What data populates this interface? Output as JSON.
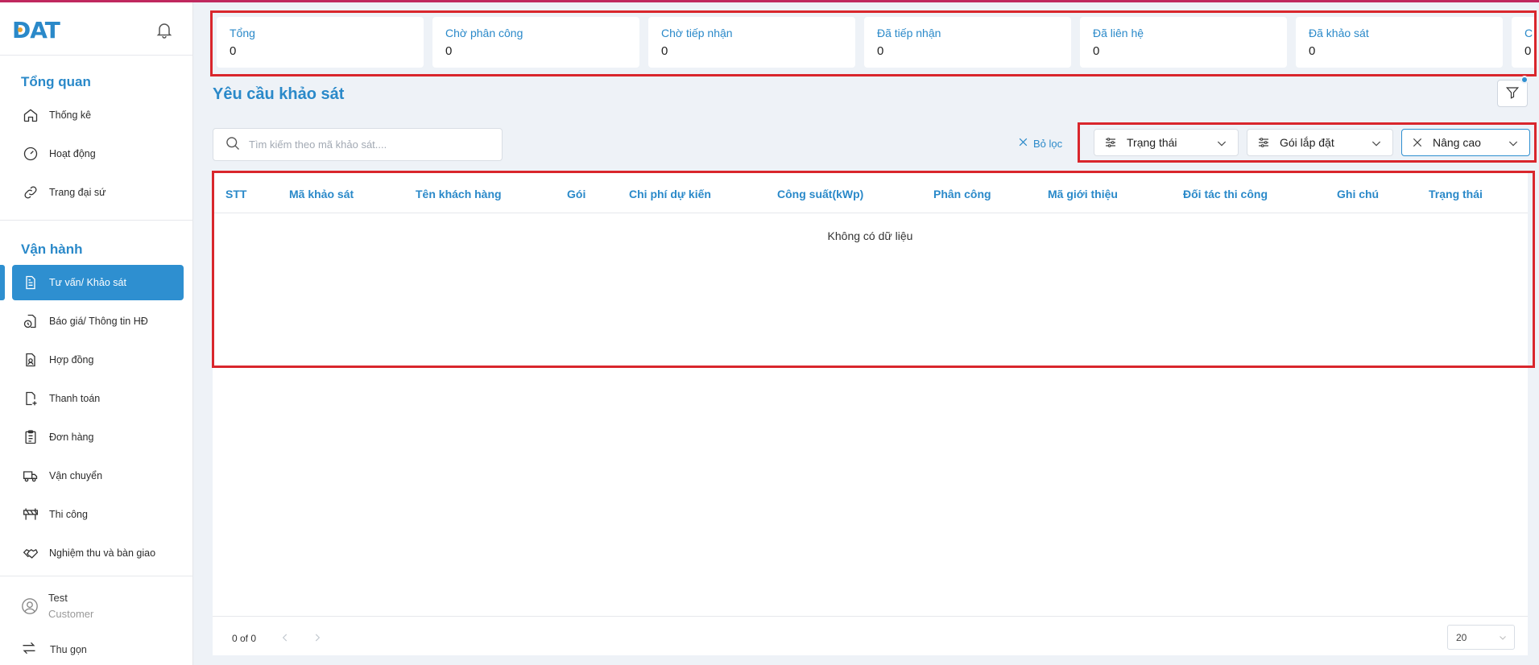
{
  "brand": {
    "logo_text": "DAT"
  },
  "sidebar": {
    "section_overview": "Tổng quan",
    "overview_items": [
      {
        "label": "Thống kê",
        "icon": "home-icon"
      },
      {
        "label": "Hoạt động",
        "icon": "gauge-icon"
      },
      {
        "label": "Trang đại sứ",
        "icon": "link-icon"
      }
    ],
    "section_operations": "Vận hành",
    "operation_items": [
      {
        "label": "Tư vấn/ Khảo sát",
        "icon": "document-icon",
        "active": true
      },
      {
        "label": "Báo giá/ Thông tin HĐ",
        "icon": "file-clock-icon"
      },
      {
        "label": "Hợp đồng",
        "icon": "contract-icon"
      },
      {
        "label": "Thanh toán",
        "icon": "file-plus-icon"
      },
      {
        "label": "Đơn hàng",
        "icon": "clipboard-list-icon"
      },
      {
        "label": "Vận chuyển",
        "icon": "truck-icon"
      },
      {
        "label": "Thi công",
        "icon": "construction-icon"
      },
      {
        "label": "Nghiệm thu và bàn giao",
        "icon": "handshake-icon"
      }
    ],
    "user": {
      "name": "Test",
      "role": "Customer"
    },
    "collapse_label": "Thu gọn"
  },
  "stats": [
    {
      "label": "Tổng",
      "value": "0"
    },
    {
      "label": "Chờ phân công",
      "value": "0"
    },
    {
      "label": "Chờ tiếp nhận",
      "value": "0"
    },
    {
      "label": "Đã tiếp nhận",
      "value": "0"
    },
    {
      "label": "Đã liên hệ",
      "value": "0"
    },
    {
      "label": "Đã khảo sát",
      "value": "0"
    },
    {
      "label": "C",
      "value": "0"
    }
  ],
  "page": {
    "title": "Yêu cầu khảo sát"
  },
  "search": {
    "placeholder": "Tìm kiếm theo mã khảo sát...."
  },
  "filters": {
    "clear_label": "Bỏ lọc",
    "status_label": "Trạng thái",
    "package_label": "Gói lắp đặt",
    "advanced_label": "Nâng cao"
  },
  "table": {
    "columns": [
      "STT",
      "Mã khảo sát",
      "Tên khách hàng",
      "Gói",
      "Chi phí dự kiến",
      "Công suất(kWp)",
      "Phân công",
      "Mã giới thiệu",
      "Đối tác thi công",
      "Ghi chú",
      "Trạng thái"
    ],
    "empty_text": "Không có dữ liệu",
    "pagination_text": "0 of 0",
    "page_size": "20"
  },
  "colors": {
    "accent": "#2e8fd0",
    "highlight_border": "#d9262c",
    "title": "#2a89c9"
  }
}
